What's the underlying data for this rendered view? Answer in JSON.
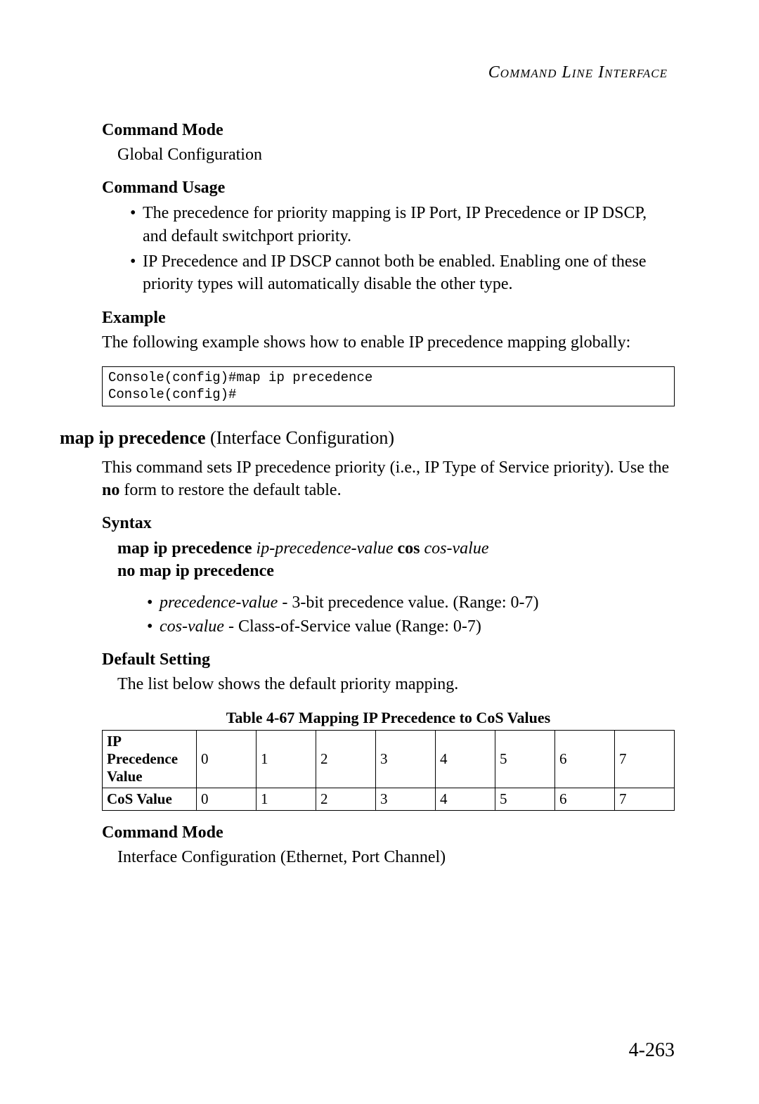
{
  "header": "Command Line Interface",
  "commandMode1": {
    "heading": "Command Mode",
    "text": "Global Configuration"
  },
  "commandUsage": {
    "heading": "Command Usage",
    "bullets": [
      "The precedence for priority mapping is IP Port, IP Precedence or IP DSCP, and default switchport priority.",
      "IP Precedence and IP DSCP cannot both be enabled. Enabling one of these priority types will automatically disable the other type."
    ]
  },
  "example": {
    "heading": "Example",
    "intro": "The following example shows how to enable IP precedence mapping globally:",
    "code": "Console(config)#map ip precedence\nConsole(config)#"
  },
  "section2": {
    "title_bold": "map ip precedence",
    "title_rest": " (Interface Configuration)",
    "desc_part1": "This command sets IP precedence priority (i.e., IP Type of Service priority). Use the ",
    "desc_bold": "no",
    "desc_part2": " form to restore the default table."
  },
  "syntax": {
    "heading": "Syntax",
    "line1_bold1": "map ip precedence",
    "line1_ital1": " ip-precedence-value ",
    "line1_bold2": "cos",
    "line1_ital2": " cos-value",
    "line2_bold": "no map ip precedence",
    "params": [
      {
        "ital": "precedence-value",
        "rest": " - 3-bit precedence value. (Range: 0-7)"
      },
      {
        "ital": "cos-value",
        "rest": " - Class-of-Service value (Range: 0-7)"
      }
    ]
  },
  "defaultSetting": {
    "heading": "Default Setting",
    "text": "The list below shows the default priority mapping."
  },
  "table": {
    "caption": "Table 4-67   Mapping IP Precedence to CoS Values",
    "row1_label": "IP Precedence Value",
    "row2_label": "CoS Value",
    "values": [
      "0",
      "1",
      "2",
      "3",
      "4",
      "5",
      "6",
      "7"
    ]
  },
  "commandMode2": {
    "heading": "Command Mode",
    "text": "Interface Configuration (Ethernet, Port Channel)"
  },
  "pageNumber": "4-263",
  "chart_data": {
    "type": "table",
    "title": "Mapping IP Precedence to CoS Values",
    "columns": [
      "IP Precedence Value",
      "CoS Value"
    ],
    "rows": [
      [
        0,
        0
      ],
      [
        1,
        1
      ],
      [
        2,
        2
      ],
      [
        3,
        3
      ],
      [
        4,
        4
      ],
      [
        5,
        5
      ],
      [
        6,
        6
      ],
      [
        7,
        7
      ]
    ]
  }
}
